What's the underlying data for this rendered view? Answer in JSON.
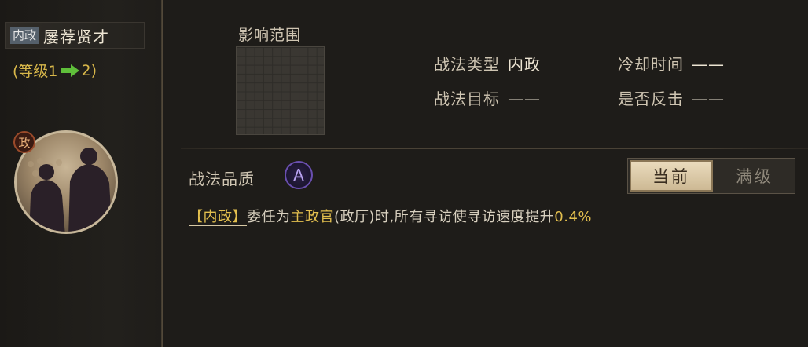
{
  "skill": {
    "type_tag": "内政",
    "name": "屡荐贤才",
    "level_prefix": "(等级1",
    "level_suffix": "2)",
    "portrait_badge": "政"
  },
  "range": {
    "label": "影响范围"
  },
  "info": {
    "type_label": "战法类型",
    "type_value": "内政",
    "cooldown_label": "冷却时间",
    "cooldown_value": "——",
    "target_label": "战法目标",
    "target_value": "——",
    "counter_label": "是否反击",
    "counter_value": "——"
  },
  "quality": {
    "label": "战法品质",
    "grade": "A"
  },
  "toggle": {
    "current": "当前",
    "max": "满级"
  },
  "description": {
    "tag": "【内政】",
    "part1": "委任为",
    "highlight1": "主政官",
    "part2": "(政厅)时,所有寻访使寻访速度提升",
    "value": "0.4%"
  },
  "colors": {
    "gold": "#e3bf4e",
    "green_arrow": "#5fbf3a",
    "quality_purple": "#6a4fb0"
  }
}
